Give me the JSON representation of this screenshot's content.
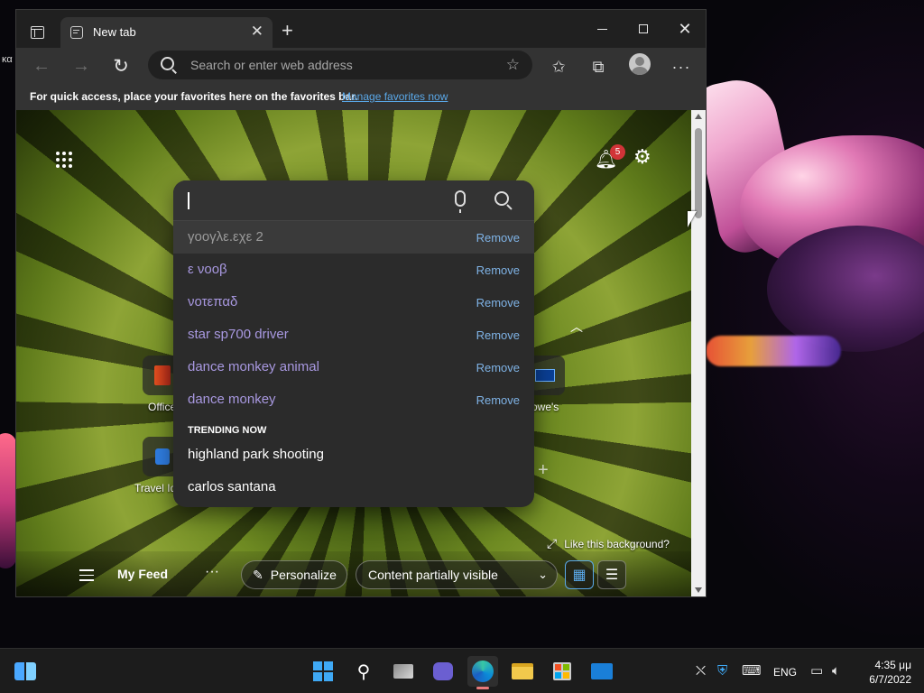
{
  "desktop": {
    "partial_label": "κα"
  },
  "browser": {
    "tab": {
      "title": "New tab",
      "close_glyph": "✕"
    },
    "new_tab_glyph": "+",
    "window": {
      "close_glyph": "✕"
    },
    "address": {
      "placeholder": "Search or enter web address"
    },
    "favorites_bar": {
      "message": "For quick access, place your favorites here on the favorites bar.",
      "link": "Manage favorites now"
    }
  },
  "newtab": {
    "notification_count": "5",
    "tiles": [
      {
        "label": "Office"
      },
      {
        "label": "Travel Id"
      },
      {
        "label": "owe's"
      }
    ],
    "like_background": "Like this background?",
    "feed": {
      "title": "My Feed",
      "more": "···",
      "personalize": "Personalize",
      "content_visibility": "Content partially visible"
    }
  },
  "search": {
    "remove_label": "Remove",
    "suggestions": [
      {
        "text": "γοογλε.εχε 2",
        "highlighted": true
      },
      {
        "text": "ε νοοβ"
      },
      {
        "text": "νοτεπαδ"
      },
      {
        "text": "star sp700 driver"
      },
      {
        "text": "dance monkey animal"
      },
      {
        "text": "dance monkey"
      }
    ],
    "trending_heading": "TRENDING NOW",
    "trending": [
      {
        "text": "highland park shooting"
      },
      {
        "text": "carlos santana"
      }
    ]
  },
  "taskbar": {
    "language": "ENG",
    "time": "4:35 μμ",
    "date": "6/7/2022"
  },
  "colors": {
    "link": "#5aa8e8",
    "suggestion_history": "#a898e0",
    "badge": "#d13438",
    "edge_indicator": "#e87a7a"
  },
  "icons": [
    "tab-actions-icon",
    "tab-favicon-icon",
    "back-arrow-icon",
    "forward-arrow-icon",
    "refresh-icon",
    "search-icon",
    "add-favorite-icon",
    "favorites-icon",
    "collections-icon",
    "profile-avatar-icon",
    "more-icon",
    "apps-grid-icon",
    "bell-icon",
    "gear-icon",
    "microphone-icon",
    "pen-icon",
    "chevron-down-icon",
    "grid-view-icon",
    "list-view-icon",
    "expand-icon"
  ]
}
